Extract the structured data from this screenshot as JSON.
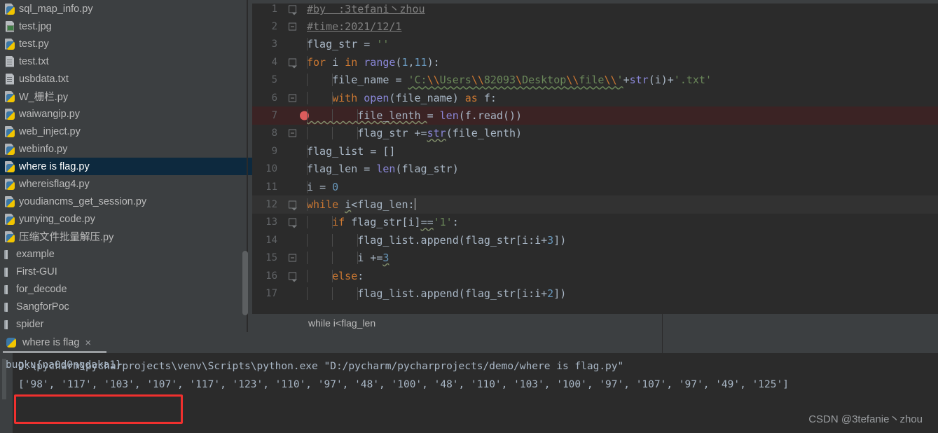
{
  "sidebar": {
    "items": [
      {
        "label": "sql_map_info.py",
        "icon": "python-file-icon",
        "type": "py",
        "selected": false
      },
      {
        "label": "test.jpg",
        "icon": "image-file-icon",
        "type": "img",
        "selected": false
      },
      {
        "label": "test.py",
        "icon": "python-file-icon",
        "type": "py",
        "selected": false
      },
      {
        "label": "test.txt",
        "icon": "text-file-icon",
        "type": "txt",
        "selected": false
      },
      {
        "label": "usbdata.txt",
        "icon": "text-file-icon",
        "type": "txt",
        "selected": false
      },
      {
        "label": "W_栅栏.py",
        "icon": "python-file-icon",
        "type": "py",
        "selected": false
      },
      {
        "label": "waiwangip.py",
        "icon": "python-file-icon",
        "type": "py",
        "selected": false
      },
      {
        "label": "web_inject.py",
        "icon": "python-file-icon",
        "type": "py",
        "selected": false
      },
      {
        "label": "webinfo.py",
        "icon": "python-file-icon",
        "type": "py",
        "selected": false
      },
      {
        "label": "where is flag.py",
        "icon": "python-file-icon",
        "type": "py",
        "selected": true
      },
      {
        "label": "whereisflag4.py",
        "icon": "python-file-icon",
        "type": "py",
        "selected": false
      },
      {
        "label": "youdiancms_get_session.py",
        "icon": "python-file-icon",
        "type": "py",
        "selected": false
      },
      {
        "label": "yunying_code.py",
        "icon": "python-file-icon",
        "type": "py",
        "selected": false
      },
      {
        "label": "压缩文件批量解压.py",
        "icon": "python-file-icon",
        "type": "py",
        "selected": false
      },
      {
        "label": "example",
        "icon": "folder-icon",
        "type": "dir",
        "selected": false
      },
      {
        "label": "First-GUI",
        "icon": "folder-icon",
        "type": "dir",
        "selected": false
      },
      {
        "label": "for_decode",
        "icon": "folder-icon",
        "type": "dir",
        "selected": false
      },
      {
        "label": "SangforPoc",
        "icon": "folder-icon",
        "type": "dir",
        "selected": false
      },
      {
        "label": "spider",
        "icon": "folder-icon",
        "type": "dir",
        "selected": false
      }
    ]
  },
  "editor": {
    "lines": [
      {
        "num": "1",
        "fold": "arrow",
        "breakpoint": false,
        "state": "normal",
        "tokens": [
          {
            "t": "#by  :3tefani丶zhou",
            "c": "c-comment"
          }
        ],
        "indent_guides": 0
      },
      {
        "num": "2",
        "fold": "dash",
        "breakpoint": false,
        "state": "normal",
        "tokens": [
          {
            "t": "#time:2021/12/1",
            "c": "c-comment"
          }
        ],
        "indent_guides": 0
      },
      {
        "num": "3",
        "fold": "none",
        "breakpoint": false,
        "state": "normal",
        "tokens": [
          {
            "t": "flag_str ",
            "c": "c-default"
          },
          {
            "t": "= ",
            "c": "c-default"
          },
          {
            "t": "''",
            "c": "c-str"
          }
        ],
        "indent_guides": 1
      },
      {
        "num": "4",
        "fold": "arrow",
        "breakpoint": false,
        "state": "normal",
        "tokens": [
          {
            "t": "for ",
            "c": "c-kw"
          },
          {
            "t": "i ",
            "c": "c-default"
          },
          {
            "t": "in ",
            "c": "c-kw"
          },
          {
            "t": "range",
            "c": "c-fn"
          },
          {
            "t": "(",
            "c": "c-default"
          },
          {
            "t": "1",
            "c": "c-num"
          },
          {
            "t": ",",
            "c": "c-default"
          },
          {
            "t": "11",
            "c": "c-num"
          },
          {
            "t": "):",
            "c": "c-default"
          }
        ],
        "indent_guides": 1
      },
      {
        "num": "5",
        "fold": "none",
        "breakpoint": false,
        "state": "normal",
        "tokens": [
          {
            "t": "    file_name ",
            "c": "c-default"
          },
          {
            "t": "= ",
            "c": "c-default"
          },
          {
            "t": "'C:",
            "c": "c-str squiggle"
          },
          {
            "t": "\\\\",
            "c": "c-str-esc squiggle"
          },
          {
            "t": "Users",
            "c": "c-str squiggle"
          },
          {
            "t": "\\\\",
            "c": "c-str-esc squiggle"
          },
          {
            "t": "82093",
            "c": "c-str squiggle"
          },
          {
            "t": "\\",
            "c": "c-str-esc squiggle"
          },
          {
            "t": "Desktop",
            "c": "c-str squiggle"
          },
          {
            "t": "\\\\",
            "c": "c-str-esc squiggle"
          },
          {
            "t": "file",
            "c": "c-str squiggle"
          },
          {
            "t": "\\\\",
            "c": "c-str-esc squiggle"
          },
          {
            "t": "'",
            "c": "c-str squiggle"
          },
          {
            "t": "+",
            "c": "c-default"
          },
          {
            "t": "str",
            "c": "c-fn"
          },
          {
            "t": "(i)+",
            "c": "c-default"
          },
          {
            "t": "'.txt'",
            "c": "c-str"
          }
        ],
        "indent_guides": 2
      },
      {
        "num": "6",
        "fold": "dash",
        "breakpoint": false,
        "state": "normal",
        "tokens": [
          {
            "t": "    ",
            "c": "c-default"
          },
          {
            "t": "with ",
            "c": "c-kw"
          },
          {
            "t": "open",
            "c": "c-fn"
          },
          {
            "t": "(file_name) ",
            "c": "c-default"
          },
          {
            "t": "as ",
            "c": "c-kw"
          },
          {
            "t": "f:",
            "c": "c-default"
          }
        ],
        "indent_guides": 2
      },
      {
        "num": "7",
        "fold": "none",
        "breakpoint": true,
        "state": "highlight-err",
        "tokens": [
          {
            "t": "        file_lenth ",
            "c": "c-default squiggle-g"
          },
          {
            "t": "= ",
            "c": "c-default"
          },
          {
            "t": "len",
            "c": "c-fn"
          },
          {
            "t": "(f.read())",
            "c": "c-default"
          }
        ],
        "indent_guides": 3
      },
      {
        "num": "8",
        "fold": "dash",
        "breakpoint": false,
        "state": "normal",
        "tokens": [
          {
            "t": "        flag_str ",
            "c": "c-default"
          },
          {
            "t": "+=",
            "c": "c-default"
          },
          {
            "t": "str",
            "c": "c-fn squiggle-g"
          },
          {
            "t": "(file_lenth)",
            "c": "c-default"
          }
        ],
        "indent_guides": 3
      },
      {
        "num": "9",
        "fold": "none",
        "breakpoint": false,
        "state": "normal",
        "tokens": [
          {
            "t": "flag_list ",
            "c": "c-default"
          },
          {
            "t": "= []",
            "c": "c-default"
          }
        ],
        "indent_guides": 1
      },
      {
        "num": "10",
        "fold": "none",
        "breakpoint": false,
        "state": "normal",
        "tokens": [
          {
            "t": "flag_len ",
            "c": "c-default"
          },
          {
            "t": "= ",
            "c": "c-default"
          },
          {
            "t": "len",
            "c": "c-fn"
          },
          {
            "t": "(flag_str)",
            "c": "c-default"
          }
        ],
        "indent_guides": 1
      },
      {
        "num": "11",
        "fold": "none",
        "breakpoint": false,
        "state": "normal",
        "tokens": [
          {
            "t": "i ",
            "c": "c-default"
          },
          {
            "t": "= ",
            "c": "c-default"
          },
          {
            "t": "0",
            "c": "c-num"
          }
        ],
        "indent_guides": 1
      },
      {
        "num": "12",
        "fold": "arrow",
        "breakpoint": false,
        "state": "caretline",
        "tokens": [
          {
            "t": "while ",
            "c": "c-kw"
          },
          {
            "t": "i",
            "c": "c-default squiggle-g"
          },
          {
            "t": "<flag_len:",
            "c": "c-default"
          }
        ],
        "indent_guides": 1,
        "caret": true
      },
      {
        "num": "13",
        "fold": "arrow",
        "breakpoint": false,
        "state": "normal",
        "tokens": [
          {
            "t": "    ",
            "c": "c-default"
          },
          {
            "t": "if ",
            "c": "c-kw"
          },
          {
            "t": "flag_str[i]",
            "c": "c-default"
          },
          {
            "t": "==",
            "c": "c-default squiggle-g"
          },
          {
            "t": "'1'",
            "c": "c-str"
          },
          {
            "t": ":",
            "c": "c-default"
          }
        ],
        "indent_guides": 2
      },
      {
        "num": "14",
        "fold": "none",
        "breakpoint": false,
        "state": "normal",
        "tokens": [
          {
            "t": "        flag_list.append(flag_str[i:i",
            "c": "c-default"
          },
          {
            "t": "+",
            "c": "c-default"
          },
          {
            "t": "3",
            "c": "c-num"
          },
          {
            "t": "])",
            "c": "c-default"
          }
        ],
        "indent_guides": 3
      },
      {
        "num": "15",
        "fold": "dash",
        "breakpoint": false,
        "state": "normal",
        "tokens": [
          {
            "t": "        i ",
            "c": "c-default"
          },
          {
            "t": "+=",
            "c": "c-default"
          },
          {
            "t": "3",
            "c": "c-num squiggle-g"
          }
        ],
        "indent_guides": 3
      },
      {
        "num": "16",
        "fold": "arrow",
        "breakpoint": false,
        "state": "normal",
        "tokens": [
          {
            "t": "    ",
            "c": "c-default"
          },
          {
            "t": "else",
            "c": "c-kw"
          },
          {
            "t": ":",
            "c": "c-default"
          }
        ],
        "indent_guides": 2
      },
      {
        "num": "17",
        "fold": "none",
        "breakpoint": false,
        "state": "normal",
        "tokens": [
          {
            "t": "        flag_list.append(flag_str[i:i",
            "c": "c-default"
          },
          {
            "t": "+",
            "c": "c-default"
          },
          {
            "t": "2",
            "c": "c-num"
          },
          {
            "t": "])",
            "c": "c-default"
          }
        ],
        "indent_guides": 3
      }
    ]
  },
  "breadcrumb": {
    "text": "while i<flag_len"
  },
  "run": {
    "tab_label": "where is flag",
    "tab_close": "×",
    "tab_icon": "python-icon",
    "console": {
      "command": "D:\\pycharm\\pycharprojects\\venv\\Scripts\\python.exe \"D:/pycharm/pycharprojects/demo/where is flag.py\"",
      "list_output": "['98', '117', '103', '107', '117', '123', '110', '97', '48', '100', '48', '110', '103', '100', '97', '107', '97', '49', '125']",
      "flag": "bugku{na0d0ngdaka1}"
    }
  },
  "watermark": {
    "text": "CSDN @3tefanie丶zhou"
  },
  "colors": {
    "editor_bg": "#2b2b2b",
    "panel_bg": "#3c3f41",
    "selection_bg": "#0d293e",
    "error_line_bg": "#3b2324",
    "breakpoint": "#db5c5c",
    "flag_box_border": "#f0302e",
    "keyword": "#cc7832",
    "string": "#6a8759",
    "number": "#6897bb",
    "function": "#8a87d8",
    "default_text": "#a9b7c6",
    "comment": "#808080"
  }
}
